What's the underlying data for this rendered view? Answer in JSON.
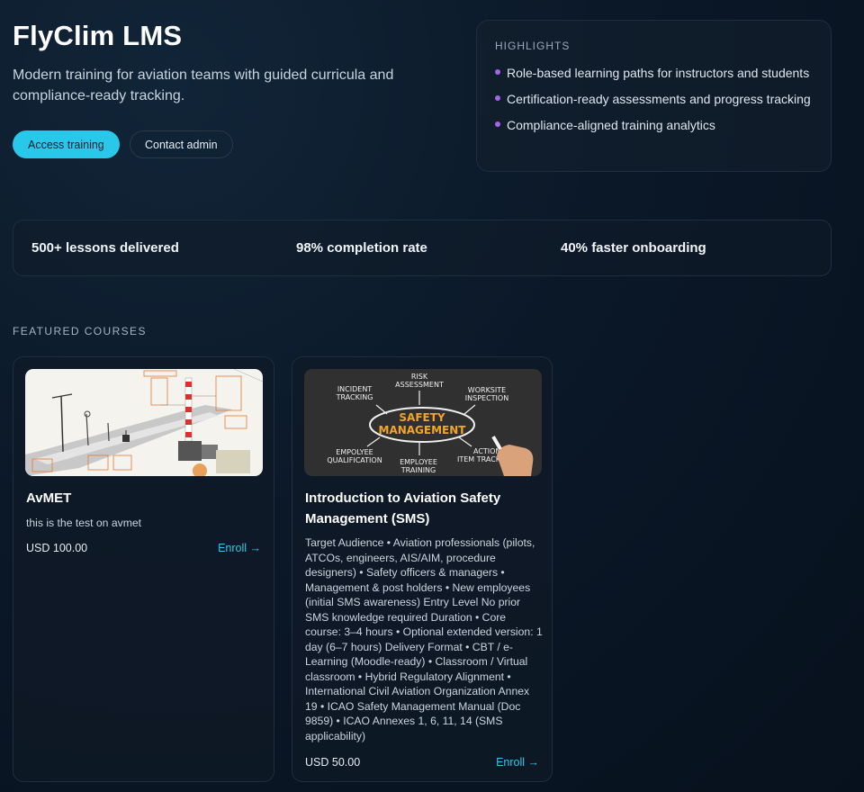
{
  "hero": {
    "title": "FlyClim LMS",
    "subtitle": "Modern training for aviation teams with guided curricula and compliance-ready tracking.",
    "primary_button": "Access training",
    "secondary_button": "Contact admin"
  },
  "highlights": {
    "title": "HIGHLIGHTS",
    "items": [
      "Role-based learning paths for instructors and students",
      "Certification-ready assessments and progress tracking",
      "Compliance-aligned training analytics"
    ]
  },
  "stats": [
    "500+ lessons delivered",
    "98% completion rate",
    "40% faster onboarding"
  ],
  "featured": {
    "label": "FEATURED COURSES",
    "courses": [
      {
        "title": "AvMET",
        "description": "this is the test on avmet",
        "price": "USD 100.00",
        "enroll": "Enroll →"
      },
      {
        "title": "Introduction to Aviation Safety Management (SMS)",
        "description": "Target Audience • Aviation professionals (pilots, ATCOs, engineers, AIS/AIM, procedure designers) • Safety officers & managers • Management & post holders • New employees (initial SMS awareness) Entry Level No prior SMS knowledge required Duration • Core course: 3–4 hours • Optional extended version: 1 day (6–7 hours) Delivery Format • CBT / e-Learning (Moodle-ready) • Classroom / Virtual classroom • Hybrid Regulatory Alignment • International Civil Aviation Organization Annex 19 • ICAO Safety Management Manual (Doc 9859) • ICAO Annexes 1, 6, 11, 14 (SMS applicability)",
        "price": "USD 50.00",
        "enroll": "Enroll →",
        "image_text": {
          "center_top": "SAFETY",
          "center_bottom": "MANAGEMENT",
          "risk": [
            "RISK",
            "ASSESSMENT"
          ],
          "incident": [
            "INCIDENT",
            "TRACKING"
          ],
          "website": [
            "WORKSITE",
            "INSPECTION"
          ],
          "employee_qual": [
            "EMPOLYEE",
            "QUALIFICATION"
          ],
          "employee_train": [
            "EMPLOYEE",
            "TRAINING"
          ],
          "action": [
            "ACTION",
            "ITEM TRACKING"
          ]
        }
      }
    ]
  },
  "colors": {
    "accent": "#29c8ea",
    "bullet": "#a266e8",
    "link": "#2fc6e6"
  }
}
